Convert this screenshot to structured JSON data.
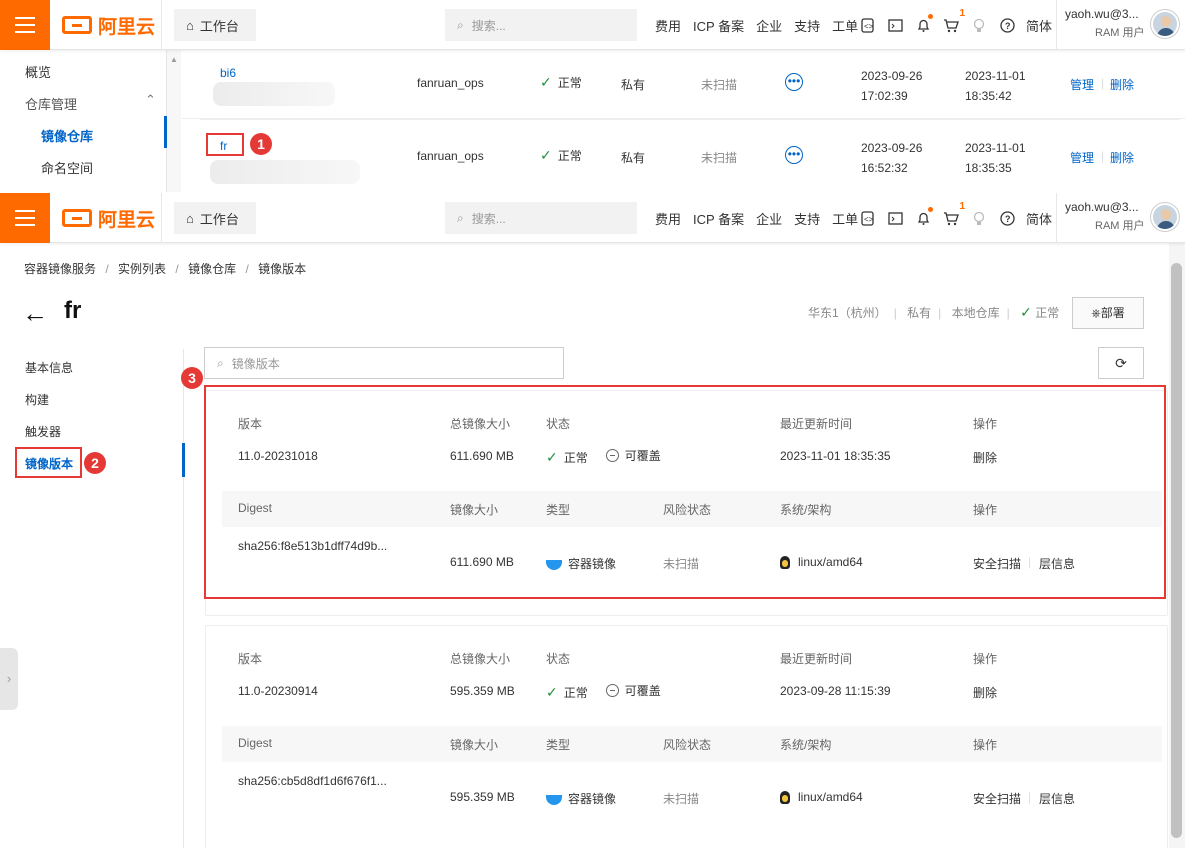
{
  "brand": {
    "name": "阿里云",
    "color": "#ff6a00"
  },
  "topbar": {
    "workbench": "工作台",
    "search_placeholder": "搜索...",
    "links": [
      "费用",
      "ICP 备案",
      "企业",
      "支持",
      "工单"
    ],
    "icons": [
      "developer-icon",
      "terminal-icon",
      "bell-icon",
      "cart-icon",
      "bulb-icon",
      "help-icon"
    ],
    "cart_badge": "1",
    "language": "简体",
    "user_name": "yaoh.wu@3...",
    "user_role": "RAM 用户"
  },
  "upper": {
    "nav": {
      "overview": "概览",
      "repo_mgmt": "仓库管理",
      "image_repo": "镜像仓库",
      "namespace": "命名空间"
    },
    "rows": [
      {
        "name": "bi6",
        "namespace": "fanruan_ops",
        "status": "正常",
        "type": "私有",
        "scan": "未扫描",
        "created_date": "2023-09-26",
        "created_time": "17:02:39",
        "updated_date": "2023-11-01",
        "updated_time": "18:35:42",
        "manage": "管理",
        "delete": "删除"
      },
      {
        "name": "fr",
        "namespace": "fanruan_ops",
        "status": "正常",
        "type": "私有",
        "scan": "未扫描",
        "created_date": "2023-09-26",
        "created_time": "16:52:32",
        "updated_date": "2023-11-01",
        "updated_time": "18:35:35",
        "manage": "管理",
        "delete": "删除"
      }
    ],
    "more": "•••",
    "marker": "1"
  },
  "lower": {
    "breadcrumb": [
      "容器镜像服务",
      "实例列表",
      "镜像仓库",
      "镜像版本"
    ],
    "breadcrumb_sep": "/",
    "repo_title": "fr",
    "back_arrow": "←",
    "meta": {
      "region": "华东1（杭州）",
      "visibility": "私有",
      "source": "本地仓库",
      "status": "正常"
    },
    "deploy_button": "部署",
    "tabs": [
      "基本信息",
      "构建",
      "触发器",
      "镜像版本"
    ],
    "tab_marker": "2",
    "card_marker": "3",
    "version_search_placeholder": "镜像版本",
    "refresh_glyph": "⟳",
    "headers": {
      "version": "版本",
      "total_size": "总镜像大小",
      "status": "状态",
      "updated": "最近更新时间",
      "action": "操作",
      "digest": "Digest",
      "size": "镜像大小",
      "type": "类型",
      "risk": "风险状态",
      "os_arch": "系统/架构"
    },
    "versions": [
      {
        "version": "11.0-20231018",
        "total_size": "611.690 MB",
        "status": "正常",
        "overwrite": "可覆盖",
        "updated": "2023-11-01 18:35:35",
        "delete": "删除",
        "digest": "sha256:f8e513b1dff74d9b...",
        "size": "611.690 MB",
        "type": "容器镜像",
        "risk": "未扫描",
        "os_arch": "linux/amd64",
        "scan": "安全扫描",
        "layers": "层信息"
      },
      {
        "version": "11.0-20230914",
        "total_size": "595.359 MB",
        "status": "正常",
        "overwrite": "可覆盖",
        "updated": "2023-09-28 11:15:39",
        "delete": "删除",
        "digest": "sha256:cb5d8df1d6f676f1...",
        "size": "595.359 MB",
        "type": "容器镜像",
        "risk": "未扫描",
        "os_arch": "linux/amd64",
        "scan": "安全扫描",
        "layers": "层信息"
      }
    ]
  },
  "colors": {
    "accent": "#ff6a00",
    "link": "#0064c8",
    "ok": "#1e8e3e",
    "annotation": "#e53935"
  }
}
